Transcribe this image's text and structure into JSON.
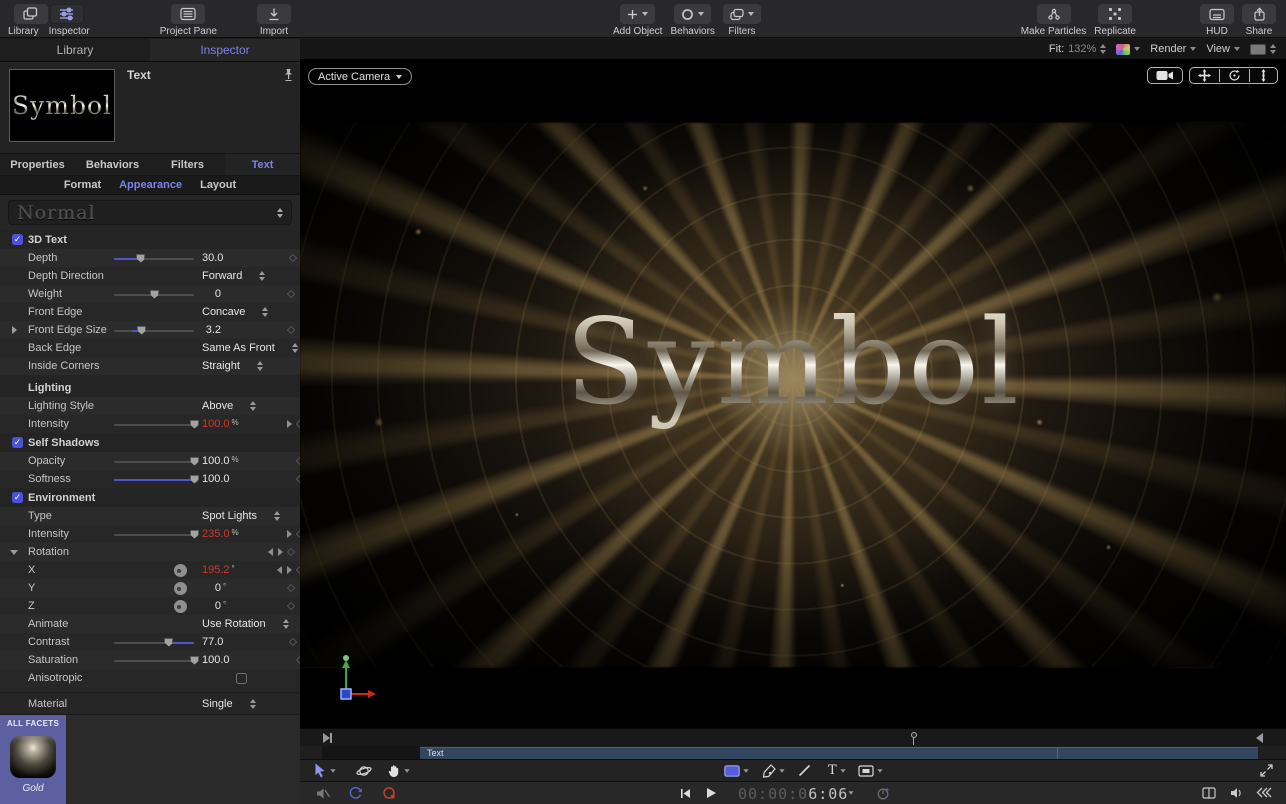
{
  "toolbar": {
    "library": "Library",
    "inspector": "Inspector",
    "project_pane": "Project Pane",
    "import": "Import",
    "add_object": "Add Object",
    "behaviors": "Behaviors",
    "filters": "Filters",
    "make_particles": "Make Particles",
    "replicate": "Replicate",
    "hud": "HUD",
    "share": "Share"
  },
  "panel_tabs": {
    "library": "Library",
    "inspector": "Inspector"
  },
  "inspector": {
    "object_title": "Text",
    "preview_text": "Symbol",
    "tabs": [
      "Properties",
      "Behaviors",
      "Filters",
      "Text"
    ],
    "active_tab": "Text",
    "subtabs": [
      "Format",
      "Appearance",
      "Layout"
    ],
    "active_subtab": "Appearance",
    "preset": "Normal",
    "rows": [
      {
        "t": "check",
        "label": "3D Text",
        "checked": true
      },
      {
        "t": "slider",
        "label": "Depth",
        "value": "30.0",
        "thumb": 33,
        "f0": 0,
        "f1": 33,
        "kf": "d"
      },
      {
        "t": "popup",
        "label": "Depth Direction",
        "value": "Forward"
      },
      {
        "t": "slider",
        "label": "Weight",
        "value": "0",
        "thumb": 50,
        "kf": "d"
      },
      {
        "t": "popup",
        "label": "Front Edge",
        "value": "Concave"
      },
      {
        "t": "slider",
        "label": "Front Edge Size",
        "value": "3.2",
        "thumb": 34,
        "f0": 22,
        "f1": 34,
        "disc": "r",
        "kf": "d"
      },
      {
        "t": "popup",
        "label": "Back Edge",
        "value": "Same As Front"
      },
      {
        "t": "popup",
        "label": "Inside Corners",
        "value": "Straight"
      },
      {
        "t": "header",
        "label": "Lighting"
      },
      {
        "t": "popup",
        "label": "Lighting Style",
        "value": "Above"
      },
      {
        "t": "slider",
        "label": "Intensity",
        "value": "100.0",
        "unit": "%",
        "red": true,
        "thumb": 100,
        "kf": "ad"
      },
      {
        "t": "check",
        "label": "Self Shadows",
        "checked": true
      },
      {
        "t": "slider",
        "label": "Opacity",
        "value": "100.0",
        "unit": "%",
        "thumb": 100,
        "kf": "d"
      },
      {
        "t": "slider",
        "label": "Softness",
        "value": "100.0",
        "thumb": 100,
        "f0": 0,
        "f1": 100,
        "kf": "d"
      },
      {
        "t": "check",
        "label": "Environment",
        "checked": true
      },
      {
        "t": "popup",
        "label": "Type",
        "value": "Spot Lights"
      },
      {
        "t": "slider",
        "label": "Intensity",
        "value": "235.0",
        "unit": "%",
        "red": true,
        "thumb": 100,
        "kf": "ad"
      },
      {
        "t": "rot",
        "label": "Rotation",
        "disc": "d",
        "kf": "bd"
      },
      {
        "t": "dial",
        "label": "X",
        "value": "195.2",
        "unit": "°",
        "red": true,
        "kf": "bd"
      },
      {
        "t": "dial",
        "label": "Y",
        "value": "0",
        "unit": "°",
        "kf": "d"
      },
      {
        "t": "dial",
        "label": "Z",
        "value": "0",
        "unit": "°",
        "kf": "d"
      },
      {
        "t": "popup",
        "label": "Animate",
        "value": "Use Rotation"
      },
      {
        "t": "slider",
        "label": "Contrast",
        "value": "77.0",
        "thumb": 68,
        "f0": 68,
        "f1": 100,
        "kf": "d"
      },
      {
        "t": "slider",
        "label": "Saturation",
        "value": "100.0",
        "thumb": 100,
        "kf": "d"
      },
      {
        "t": "checkonly",
        "label": "Anisotropic",
        "checked": false
      },
      {
        "t": "popup",
        "label": "Material",
        "value": "Single",
        "sep": true
      }
    ],
    "material": {
      "facets_header": "ALL FACETS",
      "name": "Gold"
    }
  },
  "canvas": {
    "camera_menu": "Active Camera",
    "fit_label": "Fit:",
    "fit_value": "132%",
    "render": "Render",
    "view": "View",
    "artwork_text": "Symbol"
  },
  "timeline": {
    "track_label": "Text"
  },
  "transport": {
    "timecode_full": "00:00:06:06",
    "timecode_dim": "00:00:0",
    "timecode_bright": "6:06"
  },
  "icons": {
    "text_tool_glyph": "T"
  },
  "colors": {
    "accent": "#7e82e8",
    "value_red": "#d2372c",
    "slider_fill": "#4d55cf",
    "track_blue": "#32475f",
    "material_selected": "#5c5fa0"
  }
}
